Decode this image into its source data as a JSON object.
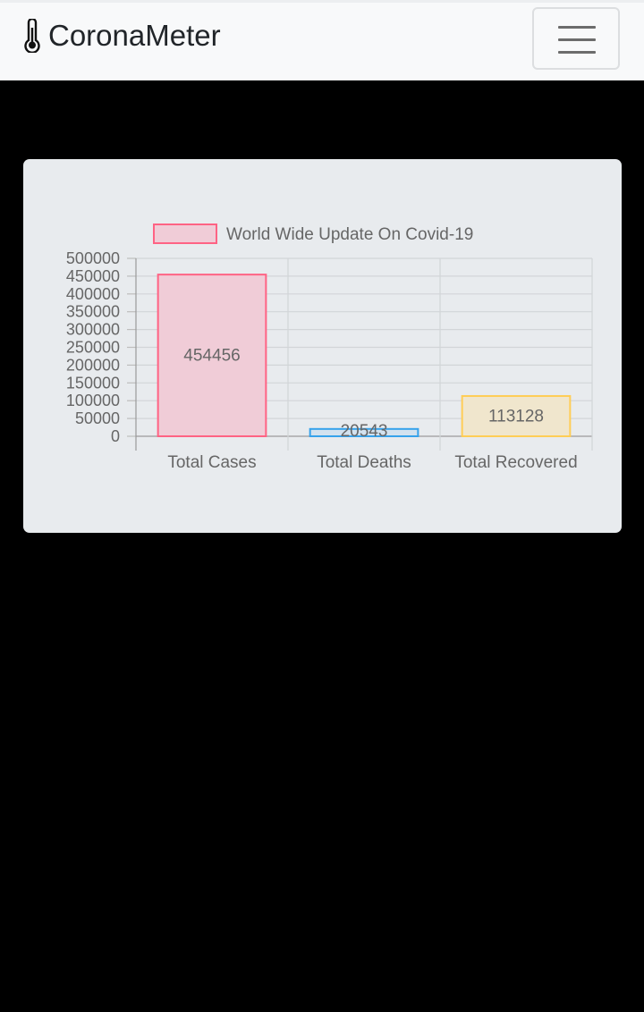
{
  "navbar": {
    "brand": "CoronaMeter",
    "brand_icon": "thermometer-icon",
    "menu_icon": "hamburger-menu-icon"
  },
  "chart_data": {
    "type": "bar",
    "categories": [
      "Total Cases",
      "Total Deaths",
      "Total Recovered"
    ],
    "series": [
      {
        "name": "World Wide Update On Covid-19",
        "values": [
          454456,
          20543,
          113128
        ],
        "fill_colors": [
          "#f0ccd7",
          "#d3e2ef",
          "#f0e6cd"
        ],
        "border_colors": [
          "#ff6384",
          "#36a2eb",
          "#ffcd56"
        ]
      }
    ],
    "data_labels": [
      "454456",
      "20543",
      "113128"
    ],
    "ylim": [
      0,
      500000
    ],
    "yticks": [
      "500000",
      "450000",
      "400000",
      "350000",
      "300000",
      "250000",
      "200000",
      "150000",
      "100000",
      "50000",
      "0"
    ],
    "legend_position": "top",
    "grid": true
  }
}
